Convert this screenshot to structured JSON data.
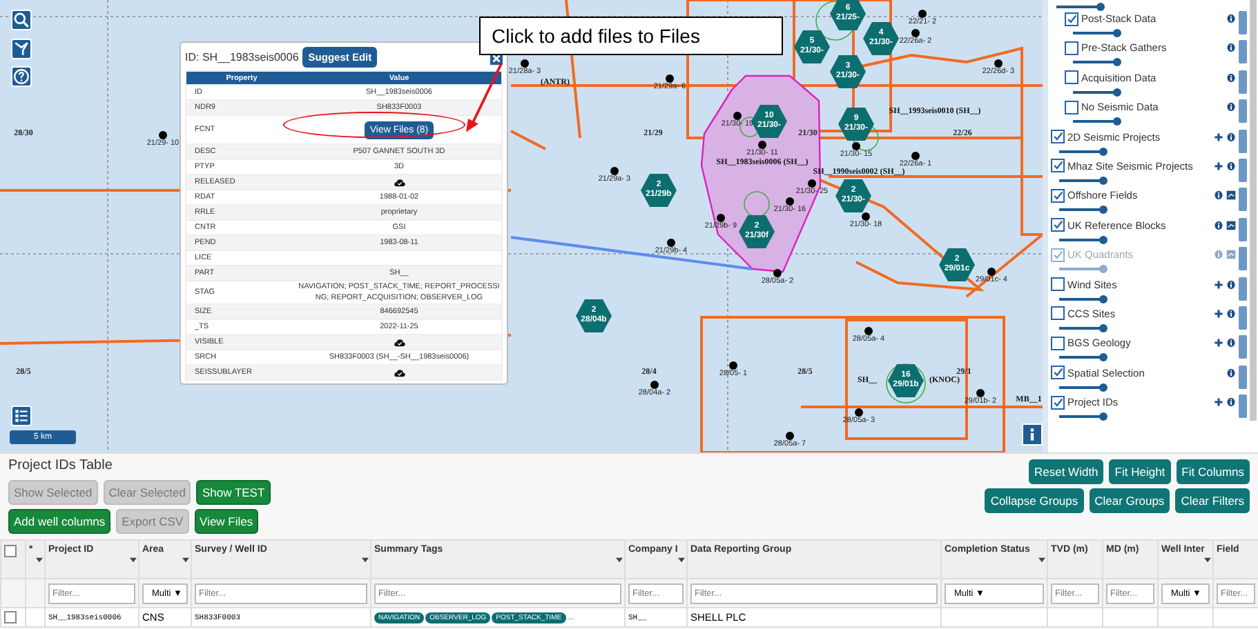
{
  "map": {
    "scale_bar": "5 km",
    "annotation": "Click to add files to Files",
    "block_labels": [
      "28/30",
      "21/29",
      "21/30",
      "22/26",
      "28/5",
      "28/4",
      "28/5",
      "29/1"
    ],
    "survey_labels": [
      "(ANTR)",
      "SH__1983seis0006 (SH__)",
      "SH__1990seis0002 (SH__)",
      "SH__1993seis0010 (SH__)",
      "SH__",
      "(KNOC)",
      "MB__1"
    ],
    "wells": [
      "22/21- 2",
      "22/26a- 2",
      "21/28a- 3",
      "22/26d- 3",
      "21/29a- 6",
      "21/30- 19",
      "21/29- 10",
      "21/30- 11",
      "21/30- 15",
      "22/26a- 1",
      "21/29a- 3",
      "21/30- 25",
      "21/30- 16",
      "21/30- 18",
      "21/29b- 9",
      "21/29b- 4",
      "29/01c- 4",
      "28/05a- 2",
      "28/05a- 4",
      "28/05- 1",
      "28/04a- 2",
      "29/01b- 2",
      "28/05a- 3",
      "28/05a- 7"
    ],
    "markers": [
      {
        "count": "6",
        "block": "21/25-"
      },
      {
        "count": "4",
        "block": "21/30-"
      },
      {
        "count": "5",
        "block": "21/30-"
      },
      {
        "count": "3",
        "block": "21/30-"
      },
      {
        "count": "10",
        "block": "21/30-"
      },
      {
        "count": "9",
        "block": "21/30-"
      },
      {
        "count": "2",
        "block": "21/29b"
      },
      {
        "count": "2",
        "block": "21/30-"
      },
      {
        "count": "2",
        "block": "21/30f"
      },
      {
        "count": "2",
        "block": "29/01c"
      },
      {
        "count": "2",
        "block": "28/04b"
      },
      {
        "count": "16",
        "block": "29/01b"
      }
    ]
  },
  "popup": {
    "title": "ID: SH__1983seis0006",
    "suggest_button": "Suggest Edit",
    "columns": [
      "Property",
      "Value"
    ],
    "rows": [
      {
        "property": "ID",
        "kind": "text",
        "value": "SH__1983seis0006"
      },
      {
        "property": "NDR9",
        "kind": "text",
        "value": "SH833F0003"
      },
      {
        "property": "FCNT",
        "kind": "button",
        "value": "View Files (8)"
      },
      {
        "property": "DESC",
        "kind": "text",
        "value": "P507 GANNET SOUTH 3D"
      },
      {
        "property": "PTYP",
        "kind": "text",
        "value": "3D"
      },
      {
        "property": "RELEASED",
        "kind": "icon"
      },
      {
        "property": "RDAT",
        "kind": "text",
        "value": "1988-01-02"
      },
      {
        "property": "RRLE",
        "kind": "text",
        "value": "proprietary"
      },
      {
        "property": "CNTR",
        "kind": "text",
        "value": "GSI"
      },
      {
        "property": "PEND",
        "kind": "text",
        "value": "1983-08-11"
      },
      {
        "property": "LICE",
        "kind": "text"
      },
      {
        "property": "PART",
        "kind": "text",
        "value": "SH__"
      },
      {
        "property": "STAG",
        "kind": "text",
        "value": "NAVIGATION; POST_STACK_TIME; REPORT_PROCESSING; REPORT_ACQUISITION; OBSERVER_LOG"
      },
      {
        "property": "SIZE",
        "kind": "text",
        "value": "846692545"
      },
      {
        "property": "_TS",
        "kind": "text",
        "value": "2022-11-25"
      },
      {
        "property": "VISIBLE",
        "kind": "icon"
      },
      {
        "property": "SRCH",
        "kind": "text",
        "value": "SH833F0003 (SH__-SH__1983seis0006)"
      },
      {
        "property": "SEISSUBLAYER",
        "kind": "icon"
      }
    ]
  },
  "layers": [
    {
      "kind": "group",
      "level": 0.95,
      "children": [
        {
          "label": "Post-Stack Data",
          "checked": true,
          "disabled": false,
          "plus": false,
          "legend": false,
          "level": 0.95
        },
        {
          "label": "Pre-Stack Gathers",
          "checked": false,
          "disabled": false,
          "plus": false,
          "legend": false,
          "level": 0.95
        },
        {
          "label": "Acquisition Data",
          "checked": false,
          "disabled": false,
          "plus": false,
          "legend": false,
          "level": 0.95
        },
        {
          "label": "No Seismic Data",
          "checked": false,
          "disabled": false,
          "plus": false,
          "legend": false,
          "level": 0.95
        }
      ]
    },
    {
      "kind": "layer",
      "label": "2D Seismic Projects",
      "checked": true,
      "disabled": false,
      "plus": true,
      "legend": false,
      "level": 0.95
    },
    {
      "kind": "layer",
      "label": "Mhaz Site Seismic Projects",
      "checked": true,
      "disabled": false,
      "plus": true,
      "legend": false,
      "level": 0.95
    },
    {
      "kind": "layer",
      "label": "Offshore Fields",
      "checked": true,
      "disabled": false,
      "plus": false,
      "legend": true,
      "level": 0.95
    },
    {
      "kind": "layer",
      "label": "UK Reference Blocks",
      "checked": true,
      "disabled": false,
      "plus": false,
      "legend": true,
      "level": 0.95
    },
    {
      "kind": "layer",
      "label": "UK Quadrants",
      "checked": true,
      "disabled": true,
      "plus": false,
      "legend": true,
      "level": 0.95
    },
    {
      "kind": "layer",
      "label": "Wind Sites",
      "checked": false,
      "disabled": false,
      "plus": true,
      "legend": false,
      "level": 0.95
    },
    {
      "kind": "layer",
      "label": "CCS Sites",
      "checked": false,
      "disabled": false,
      "plus": true,
      "legend": false,
      "level": 0.95
    },
    {
      "kind": "layer",
      "label": "BGS Geology",
      "checked": false,
      "disabled": false,
      "plus": true,
      "legend": false,
      "level": 0.95
    },
    {
      "kind": "layer",
      "label": "Spatial Selection",
      "checked": true,
      "disabled": false,
      "plus": false,
      "legend": false,
      "level": 0.95
    },
    {
      "kind": "layer",
      "label": "Project IDs",
      "checked": true,
      "disabled": false,
      "plus": true,
      "legend": false,
      "level": 0.95
    }
  ],
  "table_panel": {
    "title": "Project IDs Table",
    "left_buttons": [
      [
        {
          "label": "Show Selected",
          "disabled": true
        },
        {
          "label": "Clear Selected",
          "disabled": true
        },
        {
          "label": "Show TEST",
          "disabled": false
        }
      ],
      [
        {
          "label": "Add well columns",
          "disabled": false
        },
        {
          "label": "Export CSV",
          "disabled": true
        },
        {
          "label": "View Files",
          "disabled": false
        }
      ]
    ],
    "right_buttons": [
      [
        "Reset Width",
        "Fit Height",
        "Fit Columns"
      ],
      [
        "Collapse Groups",
        "Clear Groups",
        "Clear Filters"
      ]
    ],
    "header_checked": false,
    "columns": [
      {
        "kind": "checkbox",
        "menu": false
      },
      {
        "kind": "plain",
        "label": "*",
        "menu": true
      },
      {
        "kind": "data",
        "label": "Project ID",
        "menu": true,
        "filter": {
          "kind": "text",
          "placeholder": "Filter..."
        }
      },
      {
        "kind": "data",
        "label": "Area",
        "menu": true,
        "filter": {
          "kind": "multi",
          "label": "Multi ▼"
        }
      },
      {
        "kind": "data",
        "label": "Survey / Well ID",
        "menu": true,
        "filter": {
          "kind": "text",
          "placeholder": "Filter..."
        }
      },
      {
        "kind": "data",
        "label": "Summary Tags",
        "menu": true,
        "filter": {
          "kind": "text",
          "placeholder": "Filter..."
        }
      },
      {
        "kind": "data",
        "label": "Company I",
        "menu": true,
        "filter": {
          "kind": "text",
          "placeholder": "Filter..."
        }
      },
      {
        "kind": "data",
        "label": "Data Reporting Group",
        "menu": false,
        "filter": {
          "kind": "text",
          "placeholder": "Filter..."
        }
      },
      {
        "kind": "data",
        "label": "Completion Status",
        "menu": true,
        "filter": {
          "kind": "multi",
          "label": "Multi ▼"
        }
      },
      {
        "kind": "data",
        "label": "TVD (m)",
        "menu": false,
        "filter": {
          "kind": "text",
          "placeholder": "Filter..."
        }
      },
      {
        "kind": "data",
        "label": "MD (m)",
        "menu": false,
        "filter": {
          "kind": "text",
          "placeholder": "Filter..."
        }
      },
      {
        "kind": "data",
        "label": "Well Inter",
        "menu": true,
        "filter": {
          "kind": "multi",
          "label": "Multi ▼"
        }
      },
      {
        "kind": "data",
        "label": "Field",
        "menu": false,
        "filter": {
          "kind": "text",
          "placeholder": "Filter..."
        }
      }
    ],
    "rows": [
      {
        "checked": false,
        "cells": [
          null,
          null,
          {
            "kind": "mono",
            "text": "SH__1983seis0006"
          },
          {
            "kind": "text",
            "text": "CNS"
          },
          {
            "kind": "mono",
            "text": "SH833F0003"
          },
          {
            "kind": "tags",
            "tags": [
              "NAVIGATION",
              "OBSERVER_LOG",
              "POST_STACK_TIME"
            ],
            "more": "..."
          },
          {
            "kind": "mono",
            "text": "SH__"
          },
          {
            "kind": "text",
            "text": "SHELL PLC"
          },
          null,
          null,
          null,
          null,
          null
        ]
      }
    ]
  }
}
